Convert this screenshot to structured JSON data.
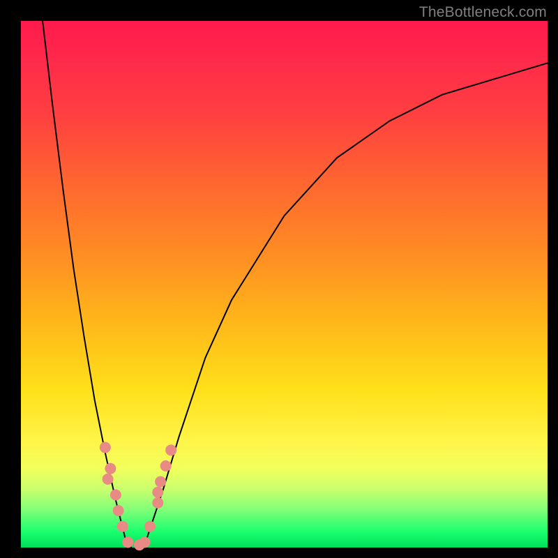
{
  "watermark": "TheBottleneck.com",
  "colors": {
    "curve": "#000000",
    "dot": "#e98b85",
    "frame": "#000000",
    "gradient_top": "#ff1a4d",
    "gradient_bottom": "#00e05a"
  },
  "chart_data": {
    "type": "line",
    "title": "",
    "xlabel": "",
    "ylabel": "",
    "xlim": [
      0,
      100
    ],
    "ylim": [
      0,
      100
    ],
    "grid": false,
    "legend": false,
    "note": "Axes are unlabeled percentage-style scales; values are read approximately from the rendered curve geometry.",
    "series": [
      {
        "name": "left-branch",
        "x": [
          4,
          6,
          8,
          10,
          12,
          14,
          16,
          18,
          19,
          20,
          21
        ],
        "values": [
          101,
          84,
          68,
          53,
          40,
          28,
          18,
          9,
          5,
          1,
          0
        ]
      },
      {
        "name": "right-branch",
        "x": [
          23,
          24,
          25,
          27,
          30,
          35,
          40,
          50,
          60,
          70,
          80,
          90,
          100
        ],
        "values": [
          0,
          2,
          5,
          11,
          21,
          36,
          47,
          63,
          74,
          81,
          86,
          89,
          92
        ]
      }
    ],
    "markers": [
      {
        "branch": "left",
        "x": 16.0,
        "y": 19.0
      },
      {
        "branch": "left",
        "x": 17.0,
        "y": 15.0
      },
      {
        "branch": "left",
        "x": 16.5,
        "y": 13.0
      },
      {
        "branch": "left",
        "x": 18.0,
        "y": 10.0
      },
      {
        "branch": "left",
        "x": 18.5,
        "y": 7.0
      },
      {
        "branch": "left",
        "x": 19.3,
        "y": 4.0
      },
      {
        "branch": "left",
        "x": 20.3,
        "y": 1.0
      },
      {
        "branch": "right",
        "x": 22.5,
        "y": 0.5
      },
      {
        "branch": "right",
        "x": 23.5,
        "y": 1.0
      },
      {
        "branch": "right",
        "x": 24.5,
        "y": 4.0
      },
      {
        "branch": "right",
        "x": 26.0,
        "y": 8.5
      },
      {
        "branch": "right",
        "x": 26.0,
        "y": 10.5
      },
      {
        "branch": "right",
        "x": 26.5,
        "y": 12.5
      },
      {
        "branch": "right",
        "x": 27.5,
        "y": 15.5
      },
      {
        "branch": "right",
        "x": 28.5,
        "y": 18.5
      }
    ]
  }
}
